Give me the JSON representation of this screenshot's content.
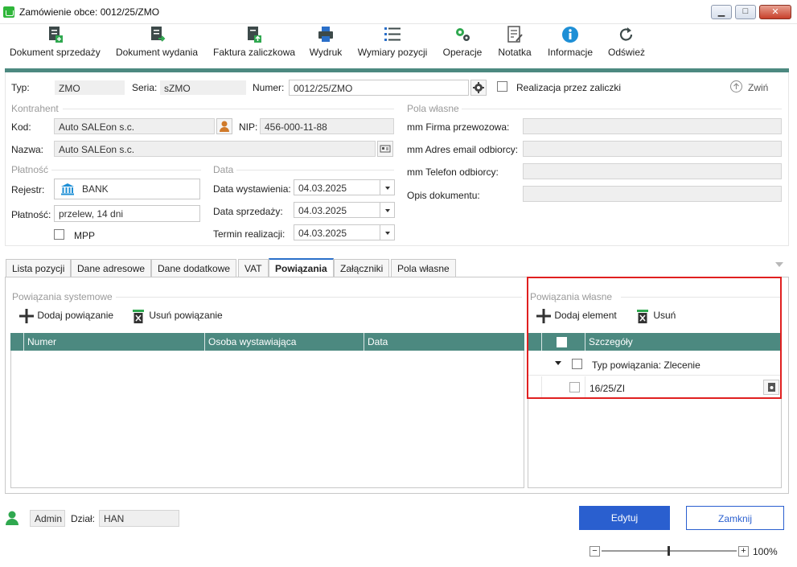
{
  "window": {
    "title": "Zamówienie obce: 0012/25/ZMO"
  },
  "toolbar": {
    "items": [
      {
        "label": "Dokument sprzedaży",
        "icon": "sales-document-icon"
      },
      {
        "label": "Dokument wydania",
        "icon": "issue-document-icon"
      },
      {
        "label": "Faktura zaliczkowa",
        "icon": "advance-invoice-icon"
      },
      {
        "label": "Wydruk",
        "icon": "printer-icon"
      },
      {
        "label": "Wymiary pozycji",
        "icon": "list-icon"
      },
      {
        "label": "Operacje",
        "icon": "gears-icon"
      },
      {
        "label": "Notatka",
        "icon": "note-icon"
      },
      {
        "label": "Informacje",
        "icon": "info-icon"
      },
      {
        "label": "Odśwież",
        "icon": "refresh-icon"
      }
    ]
  },
  "header": {
    "typ_label": "Typ:",
    "typ_value": "ZMO",
    "seria_label": "Seria:",
    "seria_value": "sZMO",
    "numer_label": "Numer:",
    "numer_value": "0012/25/ZMO",
    "zaliczki_label": "Realizacja przez zaliczki",
    "collapse_label": "Zwiń"
  },
  "kontrahent": {
    "group": "Kontrahent",
    "kod_label": "Kod:",
    "kod_value": "Auto SALEon s.c.",
    "nip_label": "NIP:",
    "nip_value": "456-000-11-88",
    "nazwa_label": "Nazwa:",
    "nazwa_value": "Auto SALEon s.c."
  },
  "platnosc": {
    "group": "Płatność",
    "rejestr_label": "Rejestr:",
    "rejestr_value": "BANK",
    "platnosc_label": "Płatność:",
    "platnosc_value": "przelew, 14 dni",
    "mpp_label": "MPP"
  },
  "data": {
    "group": "Data",
    "wystawienia_label": "Data wystawienia:",
    "wystawienia_value": "04.03.2025",
    "sprzedazy_label": "Data sprzedaży:",
    "sprzedazy_value": "04.03.2025",
    "termin_label": "Termin realizacji:",
    "termin_value": "04.03.2025"
  },
  "pola": {
    "group": "Pola własne",
    "firma_label": "mm Firma przewozowa:",
    "email_label": "mm Adres email odbiorcy:",
    "telefon_label": "mm Telefon odbiorcy:",
    "opis_label": "Opis dokumentu:"
  },
  "tabs": [
    "Lista pozycji",
    "Dane adresowe",
    "Dane dodatkowe",
    "VAT",
    "Powiązania",
    "Załączniki",
    "Pola własne"
  ],
  "system": {
    "group": "Powiązania systemowe",
    "add_label": "Dodaj powiązanie",
    "remove_label": "Usuń powiązanie",
    "columns": [
      "Numer",
      "Osoba wystawiająca",
      "Data"
    ]
  },
  "own": {
    "group": "Powiązania własne",
    "add_label": "Dodaj element",
    "remove_label": "Usuń",
    "column": "Szczegóły",
    "group_row": "Typ powiązania: Zlecenie",
    "item_row": "16/25/ZI"
  },
  "footer": {
    "user": "Admin",
    "dzial_label": "Dział:",
    "dzial_value": "HAN",
    "edit_label": "Edytuj",
    "close_label": "Zamknij",
    "zoom": "100%"
  },
  "colors": {
    "teal": "#4c8980",
    "primary": "#2a5fcf",
    "highlight": "#e02020"
  }
}
